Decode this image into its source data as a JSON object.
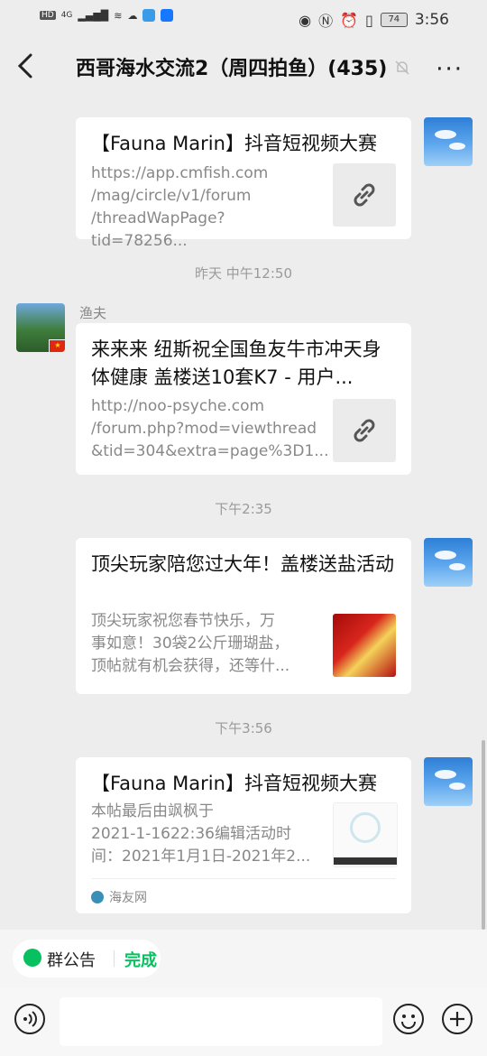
{
  "status_bar": {
    "left_labels": [
      "HD",
      "4G"
    ],
    "battery": "74",
    "time": "3:56"
  },
  "header": {
    "title": "西哥海水交流2（周四拍鱼）(435)",
    "more": "···"
  },
  "messages": [
    {
      "title": "【Fauna Marin】抖音短视频大赛",
      "desc": "https://app.cmfish.com\n/mag/circle/v1/forum\n/threadWapPage?tid=78256..."
    },
    {
      "timestamp": "昨天 中午12:50",
      "sender": "渔夫",
      "title": "来来来 纽斯祝全国鱼友牛市冲天身体健康 盖楼送10套K7 - 用户...",
      "desc": "http://noo-psyche.com\n/forum.php?mod=viewthread\n&tid=304&extra=page%3D1..."
    },
    {
      "timestamp": "下午2:35",
      "title": "顶尖玩家陪您过大年！盖楼送盐活动",
      "desc": "顶尖玩家祝您春节快乐，万\n事如意！30袋2公斤珊瑚盐，\n顶帖就有机会获得，还等什..."
    },
    {
      "timestamp": "下午3:56",
      "title": "【Fauna Marin】抖音短视频大赛",
      "desc": "本帖最后由飒枫于\n2021-1-1622:36编辑活动时\n间：2021年1月1日-2021年2...",
      "source": "海友网"
    }
  ],
  "notice": {
    "label": "群公告",
    "done": "完成"
  },
  "input": {
    "placeholder": ""
  }
}
